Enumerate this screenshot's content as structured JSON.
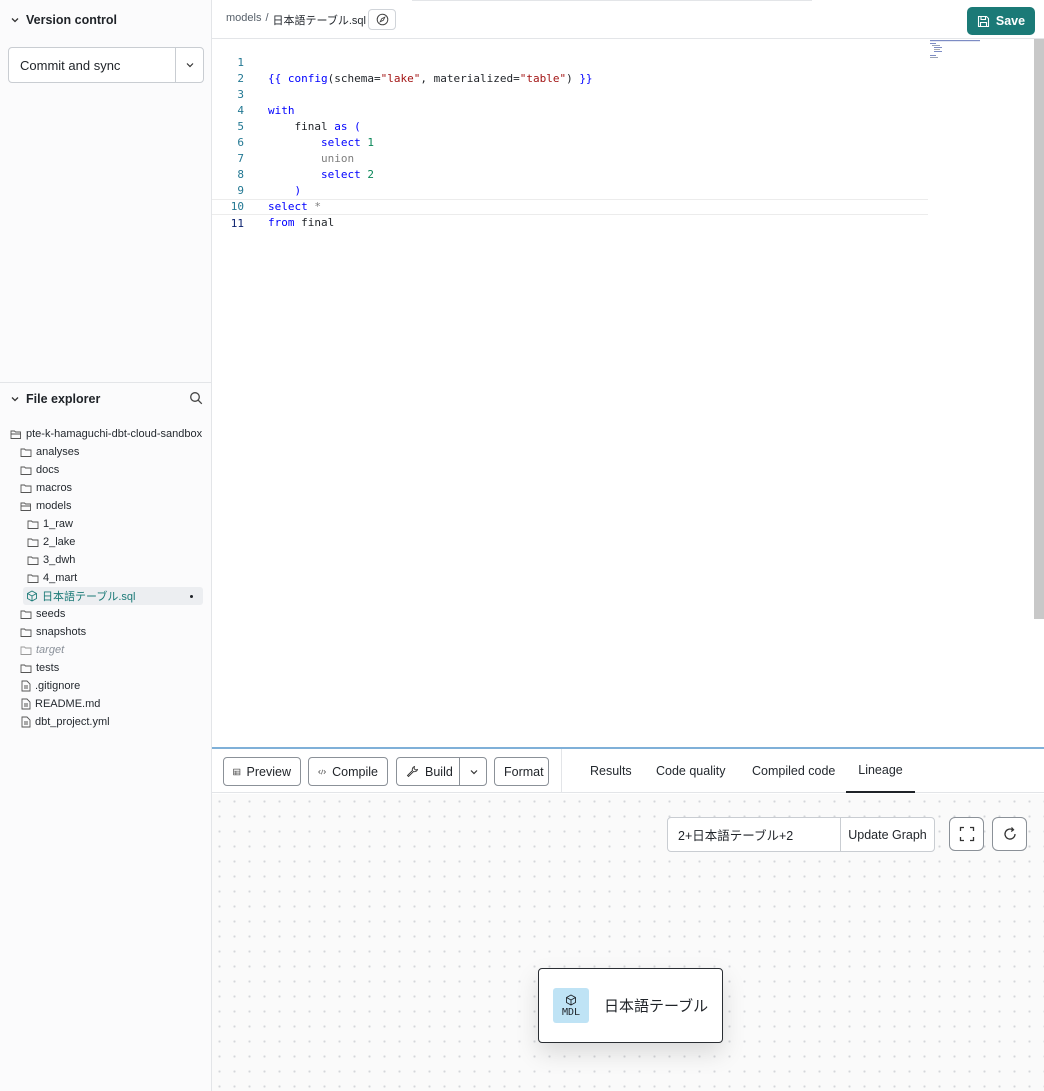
{
  "sidebar": {
    "version_control": {
      "title": "Version control",
      "commit_button": "Commit and sync"
    },
    "file_explorer": {
      "title": "File explorer",
      "items": [
        {
          "label": "pte-k-hamaguchi-dbt-cloud-sandbox",
          "type": "folder-open"
        },
        {
          "label": "analyses",
          "type": "folder"
        },
        {
          "label": "docs",
          "type": "folder"
        },
        {
          "label": "macros",
          "type": "folder"
        },
        {
          "label": "models",
          "type": "folder-open"
        },
        {
          "label": "1_raw",
          "type": "folder"
        },
        {
          "label": "2_lake",
          "type": "folder"
        },
        {
          "label": "3_dwh",
          "type": "folder"
        },
        {
          "label": "4_mart",
          "type": "folder"
        },
        {
          "label": "日本語テーブル.sql",
          "type": "model"
        },
        {
          "label": "seeds",
          "type": "folder"
        },
        {
          "label": "snapshots",
          "type": "folder"
        },
        {
          "label": "target",
          "type": "folder"
        },
        {
          "label": "tests",
          "type": "folder"
        },
        {
          "label": ".gitignore",
          "type": "file"
        },
        {
          "label": "README.md",
          "type": "file"
        },
        {
          "label": "dbt_project.yml",
          "type": "file"
        }
      ]
    }
  },
  "header": {
    "breadcrumb_parent": "models",
    "breadcrumb_separator": "/",
    "breadcrumb_current": "日本語テーブル.sql",
    "save_label": "Save"
  },
  "editor": {
    "line_numbers": [
      "1",
      "2",
      "3",
      "4",
      "5",
      "6",
      "7",
      "8",
      "9",
      "10",
      "11"
    ]
  },
  "toolbar": {
    "preview": "Preview",
    "compile": "Compile",
    "build": "Build",
    "format": "Format",
    "tabs": [
      "Results",
      "Code quality",
      "Compiled code",
      "Lineage"
    ]
  },
  "lineage": {
    "selector_value": "2+日本語テーブル+2",
    "update_button": "Update Graph",
    "node_type": "MDL",
    "node_label": "日本語テーブル"
  },
  "colors": {
    "accent": "#1b7a77",
    "keyword": "#0000ff",
    "string": "#a31515"
  }
}
